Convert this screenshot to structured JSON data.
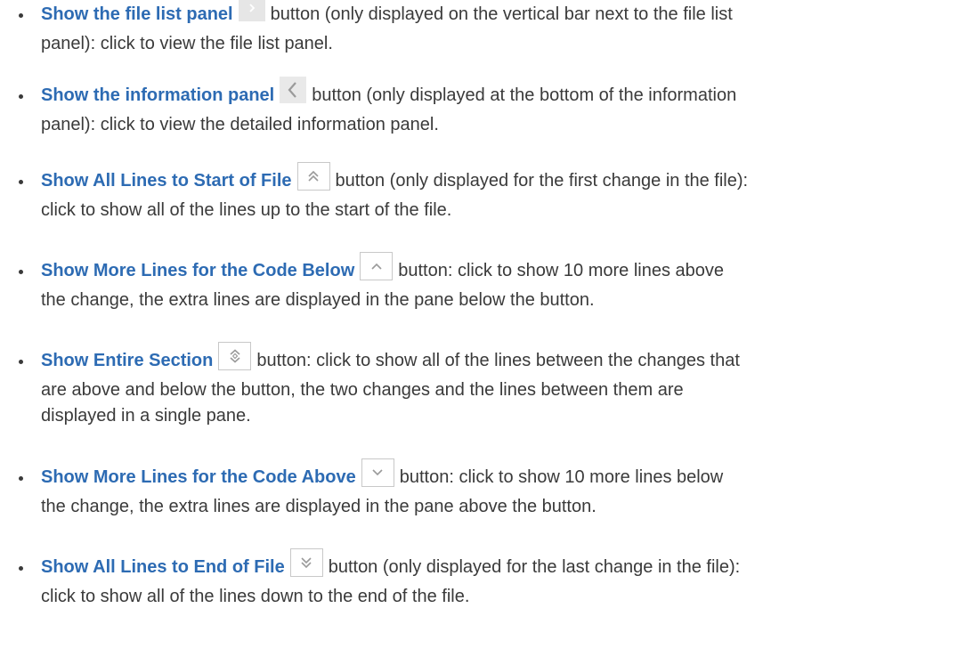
{
  "items": [
    {
      "term": "Show the file list panel",
      "icon": "chevron-right-icon",
      "line1_rest": "button (only displayed on the vertical bar next to the file list",
      "line2": "panel): click to view the file list panel.",
      "line3": ""
    },
    {
      "term": "Show the information panel",
      "icon": "chevron-left-icon",
      "line1_rest": "button (only displayed at the bottom of the information",
      "line2": "panel): click to view the detailed information panel.",
      "line3": ""
    },
    {
      "term": "Show All Lines to Start of File",
      "icon": "double-chevron-up-icon",
      "line1_rest": "button (only displayed for the first change in the file):",
      "line2": "click to show all of the lines up to the start of the file.",
      "line3": ""
    },
    {
      "term": "Show More Lines for the Code Below",
      "icon": "chevron-up-icon",
      "line1_rest": "button: click to show 10 more lines above",
      "line2": "the change, the extra lines are displayed in the pane below the button.",
      "line3": ""
    },
    {
      "term": "Show Entire Section",
      "icon": "expand-vertical-icon",
      "line1_rest": "button: click to show all of the lines between the changes that",
      "line2": "are above and below the button, the two changes and the lines between them are",
      "line3": "displayed in a single pane."
    },
    {
      "term": "Show More Lines for the Code Above",
      "icon": "chevron-down-icon",
      "line1_rest": "button: click to show 10 more lines below",
      "line2": "the change, the extra lines are displayed in the pane above the button.",
      "line3": ""
    },
    {
      "term": "Show All Lines to End of File",
      "icon": "double-chevron-down-icon",
      "line1_rest": "button (only displayed for the last change in the file):",
      "line2": "click to show all of the lines down to the end of the file.",
      "line3": ""
    }
  ],
  "colors": {
    "term": "#2d6bb3",
    "body_text": "#3a3a3a",
    "icon_stroke": "#9a9a9a",
    "icon_border": "#c8c8c8"
  }
}
